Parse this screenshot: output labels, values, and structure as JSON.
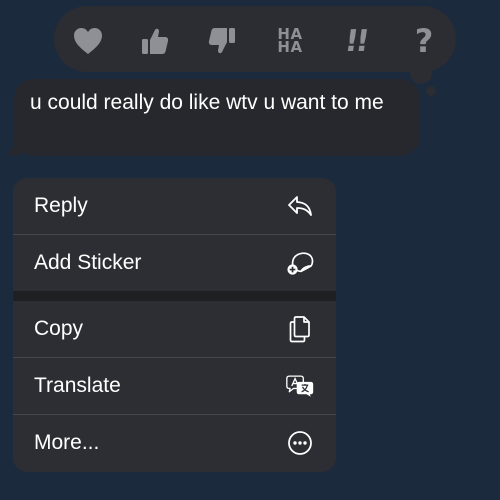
{
  "tapbacks": [
    {
      "name": "heart-icon"
    },
    {
      "name": "thumbs-up-icon"
    },
    {
      "name": "thumbs-down-icon"
    },
    {
      "name": "haha-icon",
      "line1": "HA",
      "line2": "HA"
    },
    {
      "name": "exclamation-icon",
      "glyph": "!!"
    },
    {
      "name": "question-icon",
      "glyph": "?"
    }
  ],
  "message": {
    "text": "u could really do like wtv u want to me"
  },
  "menu": {
    "items": [
      {
        "label": "Reply",
        "icon": "reply-arrow-icon"
      },
      {
        "label": "Add Sticker",
        "icon": "add-sticker-icon"
      },
      {
        "label": "Copy",
        "icon": "copy-document-icon"
      },
      {
        "label": "Translate",
        "icon": "translate-icon"
      },
      {
        "label": "More...",
        "icon": "more-ellipsis-icon"
      }
    ]
  },
  "colors": {
    "background": "#1b2a3d",
    "surface": "#2b2d33",
    "bubble": "#26282d",
    "tapback_icon": "#8e9096",
    "text": "#ffffff"
  }
}
